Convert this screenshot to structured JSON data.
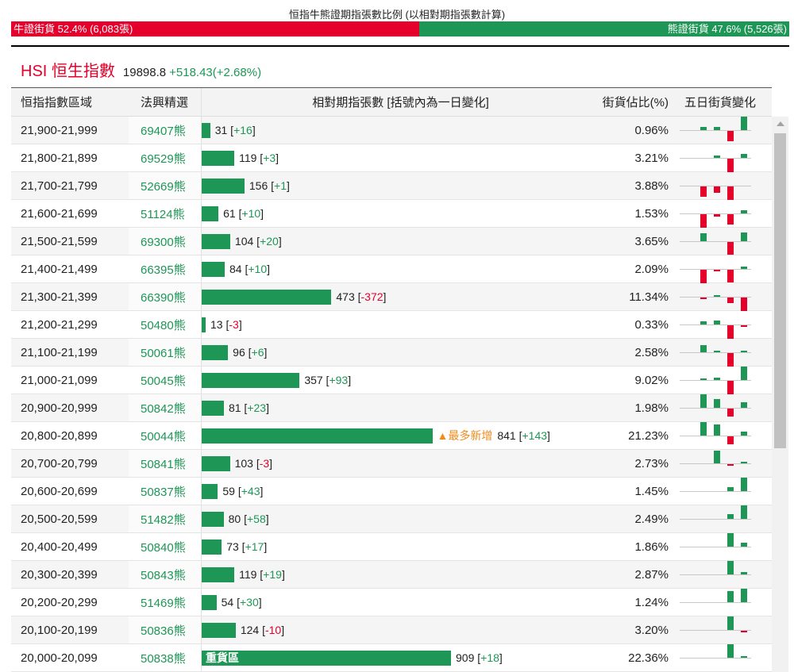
{
  "ratio": {
    "title": "恒指牛熊證期指張數比例 (以相對期指張數計算)",
    "bull_label": "牛證街貨 52.4% (6,083張)",
    "bear_label": "熊證街貨 47.6% (5,526張)",
    "bull_pct": 52.4,
    "bear_pct": 47.6
  },
  "index": {
    "name": "HSI 恒生指數",
    "value": "19898.8",
    "change": "+518.43(+2.68%)"
  },
  "headers": {
    "range": "恒指指數區域",
    "pick": "法興精選",
    "contracts": "相對期指張數 [括號內為一日變化]",
    "share": "街貨佔比(%)",
    "five_day": "五日街貨變化"
  },
  "colors": {
    "bull": "#e4002b",
    "bear": "#1e9656",
    "highlight": "#f08c1e"
  },
  "max_contracts": 909,
  "rows": [
    {
      "range": "21,900-21,999",
      "pick": "69407熊",
      "count": 31,
      "delta": "+16",
      "share": "0.96%",
      "five_day": [
        0,
        0.24,
        0.24,
        -0.76,
        1
      ]
    },
    {
      "range": "21,800-21,899",
      "pick": "69529熊",
      "count": 119,
      "delta": "+3",
      "share": "3.21%",
      "five_day": [
        0,
        0,
        0.18,
        -1,
        0.3
      ]
    },
    {
      "range": "21,700-21,799",
      "pick": "52669熊",
      "count": 156,
      "delta": "+1",
      "share": "3.88%",
      "five_day": [
        0,
        -0.76,
        -0.47,
        -1,
        0
      ]
    },
    {
      "range": "21,600-21,699",
      "pick": "51124熊",
      "count": 61,
      "delta": "+10",
      "share": "1.53%",
      "five_day": [
        0,
        -1,
        -0.18,
        -0.76,
        0.24
      ]
    },
    {
      "range": "21,500-21,599",
      "pick": "69300熊",
      "count": 104,
      "delta": "+20",
      "share": "3.65%",
      "five_day": [
        0,
        0.59,
        0,
        -0.94,
        0.65
      ]
    },
    {
      "range": "21,400-21,499",
      "pick": "66395熊",
      "count": 84,
      "delta": "+10",
      "share": "2.09%",
      "five_day": [
        0,
        -1,
        -0.12,
        -0.94,
        0.18
      ]
    },
    {
      "range": "21,300-21,399",
      "pick": "66390熊",
      "count": 473,
      "delta": "-372",
      "share": "11.34%",
      "five_day": [
        0,
        -0.12,
        0.12,
        -0.41,
        -1
      ]
    },
    {
      "range": "21,200-21,299",
      "pick": "50480熊",
      "count": 13,
      "delta": "-3",
      "share": "0.33%",
      "five_day": [
        0,
        0.24,
        0.3,
        -1,
        -0.12
      ]
    },
    {
      "range": "21,100-21,199",
      "pick": "50061熊",
      "count": 96,
      "delta": "+6",
      "share": "2.58%",
      "five_day": [
        0,
        0.53,
        0.12,
        -1,
        0.12
      ]
    },
    {
      "range": "21,000-21,099",
      "pick": "50045熊",
      "count": 357,
      "delta": "+93",
      "share": "9.02%",
      "five_day": [
        0,
        0.06,
        0.18,
        -1,
        1
      ]
    },
    {
      "range": "20,900-20,999",
      "pick": "50842熊",
      "count": 81,
      "delta": "+23",
      "share": "1.98%",
      "five_day": [
        0,
        1,
        0.65,
        -0.59,
        0.41
      ]
    },
    {
      "range": "20,800-20,899",
      "pick": "50044熊",
      "count": 841,
      "delta": "+143",
      "share": "21.23%",
      "five_day": [
        0,
        1,
        0.82,
        -0.59,
        0.3
      ],
      "tag": "▲最多新增"
    },
    {
      "range": "20,700-20,799",
      "pick": "50841熊",
      "count": 103,
      "delta": "-3",
      "share": "2.73%",
      "five_day": [
        0,
        0,
        0.94,
        -0.12,
        0.06
      ]
    },
    {
      "range": "20,600-20,699",
      "pick": "50837熊",
      "count": 59,
      "delta": "+43",
      "share": "1.45%",
      "five_day": [
        0,
        0,
        0,
        0.3,
        1
      ]
    },
    {
      "range": "20,500-20,599",
      "pick": "51482熊",
      "count": 80,
      "delta": "+58",
      "share": "2.49%",
      "five_day": [
        0,
        0,
        0,
        0.35,
        1
      ]
    },
    {
      "range": "20,400-20,499",
      "pick": "50840熊",
      "count": 73,
      "delta": "+17",
      "share": "1.86%",
      "five_day": [
        0,
        0,
        0,
        1,
        0.3
      ]
    },
    {
      "range": "20,300-20,399",
      "pick": "50843熊",
      "count": 119,
      "delta": "+19",
      "share": "2.87%",
      "five_day": [
        0,
        0,
        0,
        1,
        0.18
      ]
    },
    {
      "range": "20,200-20,299",
      "pick": "51469熊",
      "count": 54,
      "delta": "+30",
      "share": "1.24%",
      "five_day": [
        0,
        0,
        0,
        0.82,
        1
      ]
    },
    {
      "range": "20,100-20,199",
      "pick": "50836熊",
      "count": 124,
      "delta": "-10",
      "share": "3.20%",
      "five_day": [
        0,
        0,
        0,
        1,
        -0.06
      ]
    },
    {
      "range": "20,000-20,099",
      "pick": "50838熊",
      "count": 909,
      "delta": "+18",
      "share": "22.36%",
      "five_day": [
        0,
        0,
        0,
        1,
        0.12
      ],
      "bar_label": "重貨區"
    }
  ]
}
